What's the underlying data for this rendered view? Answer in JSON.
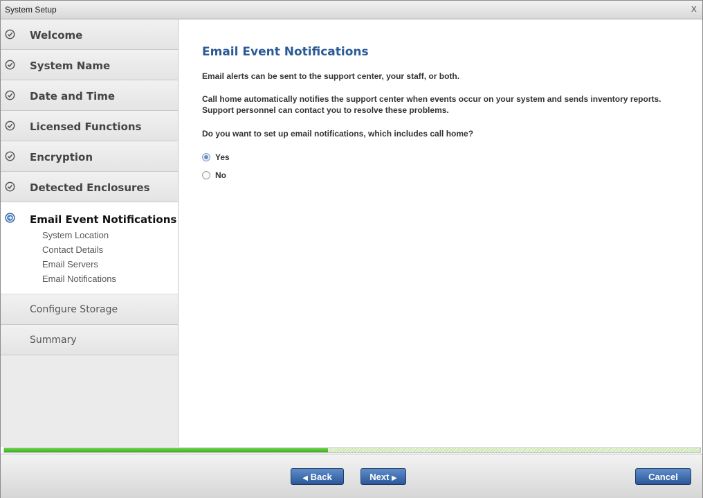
{
  "window": {
    "title": "System Setup",
    "close_glyph": "x"
  },
  "sidebar": {
    "steps": [
      {
        "label": "Welcome",
        "status": "complete",
        "icon": "check-circle-icon"
      },
      {
        "label": "System Name",
        "status": "complete",
        "icon": "check-circle-icon"
      },
      {
        "label": "Date and Time",
        "status": "complete",
        "icon": "check-circle-icon"
      },
      {
        "label": "Licensed Functions",
        "status": "complete",
        "icon": "check-circle-icon"
      },
      {
        "label": "Encryption",
        "status": "complete",
        "icon": "check-circle-icon"
      },
      {
        "label": "Detected Enclosures",
        "status": "complete",
        "icon": "check-circle-icon"
      },
      {
        "label": "Email Event Notifications",
        "status": "current",
        "icon": "arrow-circle-icon",
        "substeps": [
          "System Location",
          "Contact Details",
          "Email Servers",
          "Email Notifications"
        ]
      },
      {
        "label": "Configure Storage",
        "status": "pending"
      },
      {
        "label": "Summary",
        "status": "pending"
      }
    ]
  },
  "main": {
    "heading": "Email Event Notifications",
    "intro": "Email alerts can be sent to the support center, your staff, or both.",
    "callhome": "Call home automatically notifies the support center when events occur on your system and sends inventory reports. Support personnel can contact you to resolve these problems.",
    "question": "Do you want to set up email notifications, which includes call home?",
    "options": [
      {
        "label": "Yes",
        "selected": true
      },
      {
        "label": "No",
        "selected": false
      }
    ]
  },
  "progress": {
    "fraction": 0.465
  },
  "footer": {
    "back_label": "Back",
    "next_label": "Next",
    "cancel_label": "Cancel"
  },
  "colors": {
    "heading": "#2b5b97",
    "button": "#2a5899",
    "progress": "#3aae24"
  }
}
